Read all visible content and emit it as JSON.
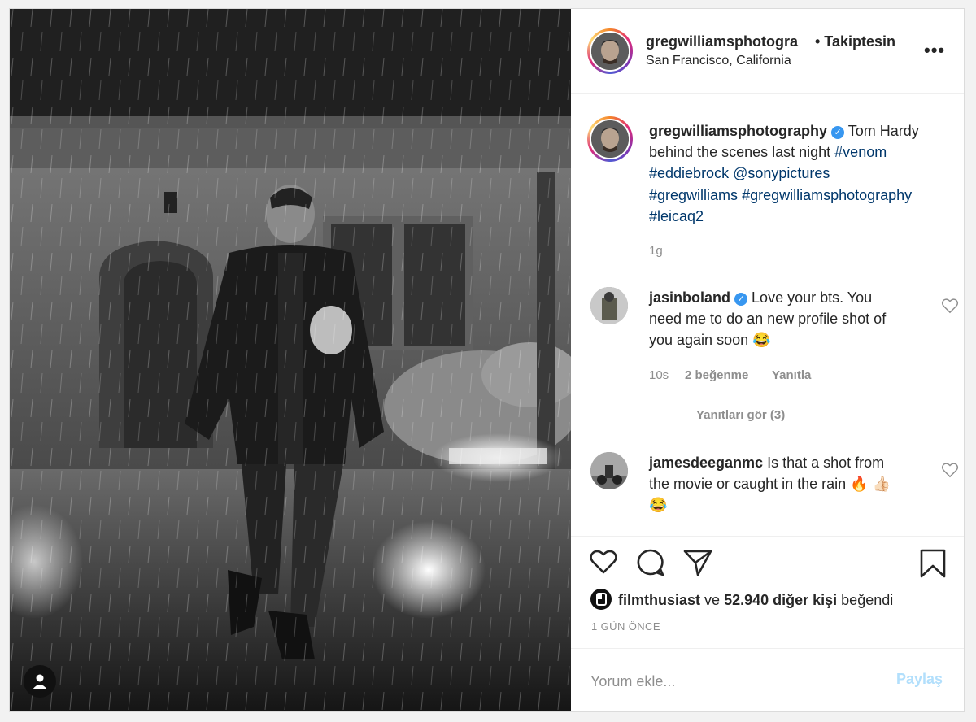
{
  "post": {
    "header": {
      "username": "gregwilliamsphotogra",
      "follow_status": "• Takiptesin",
      "location": "San Francisco, California",
      "more_icon": "more-horizontal-icon",
      "more_label": "•••"
    },
    "caption": {
      "username": "gregwilliamsphotography",
      "verified_mark": "✓",
      "text_1": "Tom Hardy",
      "text_2": "behind the scenes last night",
      "tag_venom": "#venom",
      "tag_eddiebrock": "#eddiebrock",
      "mention_sony": "@sonypictures",
      "tag_gregwilliams": "#gregwilliams",
      "tag_gregwilliamsphotography": "#gregwilliamsphotography",
      "tag_leicaq2": "#leicaq2",
      "age": "1g"
    },
    "comments": [
      {
        "username": "jasinboland",
        "verified_mark": "✓",
        "line_1": "Love your bts. You",
        "line_2": "need me to do an new profile shot of",
        "line_3": "you again soon 😂",
        "age": "10s",
        "likes": "2 beğenme",
        "reply": "Yanıtla",
        "view_replies": "Yanıtları gör (3)"
      },
      {
        "username": "jamesdeeganmc",
        "line_1": "Is that a shot from",
        "line_2": "the movie or caught in the rain 🔥 👍🏻",
        "line_3": "😂"
      }
    ],
    "likes": {
      "first_liker": "filmthusiast",
      "connector": "ve",
      "others": "52.940 diğer kişi",
      "suffix": "beğendi"
    },
    "time_ago": "1 GÜN ÖNCE",
    "comment_box": {
      "placeholder": "Yorum ekle...",
      "post_label": "Paylaş"
    },
    "icons": [
      "heart-icon",
      "comment-icon",
      "share-icon",
      "bookmark-icon",
      "tag-user-icon"
    ]
  }
}
